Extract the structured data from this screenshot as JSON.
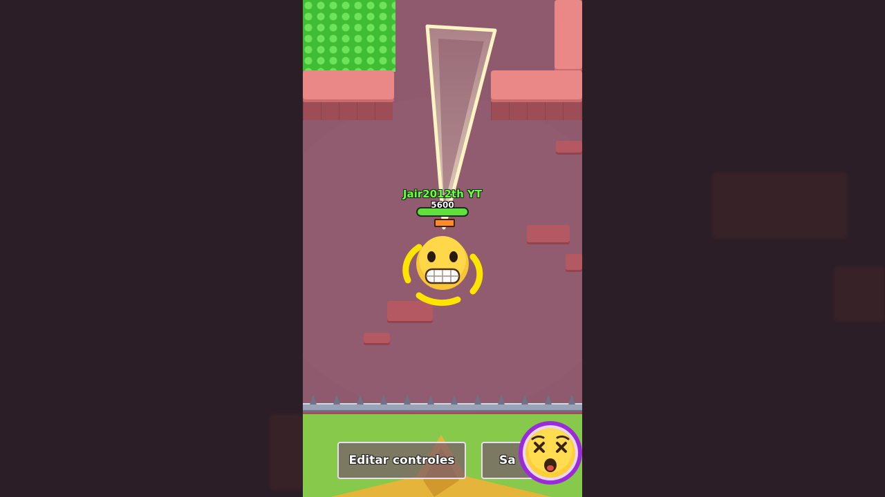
{
  "player": {
    "name": "Jair2012th YT",
    "health": "5600",
    "health_fraction": 1.0
  },
  "controls": {
    "edit_label": "Editar controles",
    "exit_label": "Sa"
  },
  "icons": {
    "player_emoji": "grimacing-face-icon",
    "emote_button": "dizzy-face-icon"
  },
  "colors": {
    "arena_floor": "#8f5a6e",
    "wall": "#e98886",
    "grass": "#3fbd35",
    "name_text": "#6bff3a",
    "health_bar": "#5fe03c",
    "emote_ring": "#9a2bd8"
  }
}
